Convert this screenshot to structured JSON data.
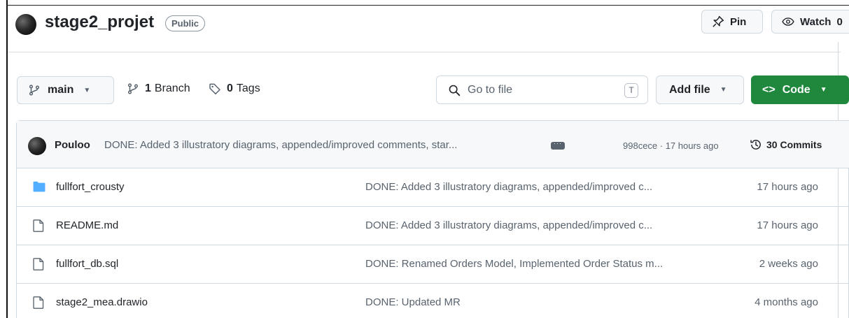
{
  "repo": {
    "name": "stage2_projet",
    "visibility": "Public"
  },
  "actions": {
    "pin_label": "Pin",
    "watch_label": "Watch",
    "watch_count": "0"
  },
  "toolbar": {
    "branch_selected": "main",
    "branch_count": "1",
    "branch_label": "Branch",
    "tag_count": "0",
    "tag_label": "Tags",
    "goto_placeholder": "Go to file",
    "goto_shortcut": "T",
    "add_file_label": "Add file",
    "code_glyph": "<>",
    "code_label": "Code"
  },
  "latest_commit": {
    "author": "Pouloo",
    "message": "DONE: Added 3 illustratory diagrams, appended/improved comments, star...",
    "meta": "998cece · 17 hours ago",
    "commits_label": "30 Commits"
  },
  "files": [
    {
      "name": "fullfort_crousty",
      "type": "folder",
      "message": "DONE: Added 3 illustratory diagrams, appended/improved c...",
      "age": "17 hours ago"
    },
    {
      "name": "README.md",
      "type": "file",
      "message": "DONE: Added 3 illustratory diagrams, appended/improved c...",
      "age": "17 hours ago"
    },
    {
      "name": "fullfort_db.sql",
      "type": "file",
      "message": "DONE: Renamed Orders Model, Implemented Order Status m...",
      "age": "2 weeks ago"
    },
    {
      "name": "stage2_mea.drawio",
      "type": "file",
      "message": "DONE: Updated MR",
      "age": "4 months ago"
    }
  ],
  "colors": {
    "primary_green": "#1f883d",
    "folder_blue": "#54aeff",
    "muted_text": "#59636e"
  }
}
